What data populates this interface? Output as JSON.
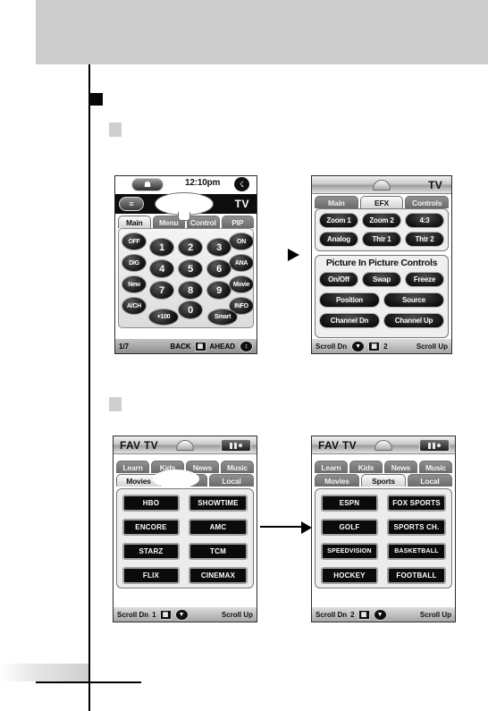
{
  "page": {
    "banner_label": "",
    "bullets": [
      {
        "name": "section-bullet-dark",
        "style": "dark"
      },
      {
        "name": "step-bullet-1",
        "style": "gray"
      },
      {
        "name": "step-bullet-2",
        "style": "gray"
      }
    ]
  },
  "screen_main": {
    "status": {
      "home_icon": "home-icon",
      "clock": "12:10pm",
      "battery_icon": "battery-icon"
    },
    "titlebar": {
      "menu_icon": "menu-list-icon",
      "title": "TV"
    },
    "tabs": [
      {
        "label": "Main",
        "active": true
      },
      {
        "label": "Menu",
        "active": false
      },
      {
        "label": "Control",
        "active": false
      },
      {
        "label": "PIP",
        "active": false
      }
    ],
    "left_keys": [
      "OFF",
      "DIG",
      "New",
      "A/CH"
    ],
    "right_keys": [
      "ON",
      "ANA",
      "Movie",
      "INFO"
    ],
    "numeric_keys": [
      "1",
      "2",
      "3",
      "4",
      "5",
      "6",
      "7",
      "8",
      "9",
      "0"
    ],
    "hundred_key": "+100",
    "smart_key": "Smart",
    "statusbar": {
      "page": "1/7",
      "back": "BACK",
      "ahead": "AHEAD",
      "center_icon": "book-icon",
      "right_icon": "updown-arrows-icon"
    }
  },
  "screen_efx": {
    "titlebar": {
      "title": "TV",
      "dome_icon": "dome-icon",
      "badge_icon": "device-icon"
    },
    "tabs": [
      {
        "label": "Main",
        "active": false
      },
      {
        "label": "EFX",
        "active": true
      },
      {
        "label": "Controls",
        "active": false
      }
    ],
    "aspect_keys": [
      "Zoom 1",
      "Zoom 2",
      "4:3",
      "Analog",
      "Thtr 1",
      "Thtr 2"
    ],
    "pip_heading": "Picture In Picture Controls",
    "pip_keys_row1": [
      "On/Off",
      "Swap",
      "Freeze"
    ],
    "pip_keys_row2": [
      "Position",
      "Source"
    ],
    "pip_keys_row3": [
      "Channel Dn",
      "Channel Up"
    ],
    "statusbar": {
      "scroll_down": "Scroll Dn",
      "scroll_up": "Scroll Up",
      "page": "2",
      "down_icon": "scroll-down-icon",
      "book_icon": "book-icon"
    }
  },
  "screen_fav_movies": {
    "titlebar": {
      "title": "FAV TV",
      "dome_icon": "dome-icon",
      "badge_icon": "device-icon"
    },
    "tabs_row1": [
      {
        "label": "Learn",
        "active": false
      },
      {
        "label": "Kids",
        "active": false
      },
      {
        "label": "News",
        "active": false
      },
      {
        "label": "Music",
        "active": false
      }
    ],
    "tabs_row2": [
      {
        "label": "Movies",
        "active": true
      },
      {
        "label": "",
        "active": false
      },
      {
        "label": "Local",
        "active": false
      }
    ],
    "channel_keys": [
      "HBO",
      "SHOWTIME",
      "ENCORE",
      "AMC",
      "STARZ",
      "TCM",
      "FLIX",
      "CINEMAX"
    ],
    "statusbar": {
      "scroll_down": "Scroll Dn",
      "scroll_up": "Scroll Up",
      "page": "1",
      "book_icon": "book-icon",
      "down_icon": "scroll-down-icon"
    }
  },
  "screen_fav_sports": {
    "titlebar": {
      "title": "FAV TV",
      "dome_icon": "dome-icon",
      "badge_icon": "device-icon"
    },
    "tabs_row1": [
      {
        "label": "Learn",
        "active": false
      },
      {
        "label": "Kids",
        "active": false
      },
      {
        "label": "News",
        "active": false
      },
      {
        "label": "Music",
        "active": false
      }
    ],
    "tabs_row2": [
      {
        "label": "Movies",
        "active": false
      },
      {
        "label": "Sports",
        "active": true
      },
      {
        "label": "Local",
        "active": false
      }
    ],
    "channel_keys": [
      "ESPN",
      "FOX SPORTS",
      "GOLF",
      "SPORTS CH.",
      "SPEEDVISION",
      "BASKETBALL",
      "HOCKEY",
      "FOOTBALL"
    ],
    "statusbar": {
      "scroll_down": "Scroll Dn",
      "scroll_up": "Scroll Up",
      "page": "2",
      "book_icon": "book-icon",
      "down_icon": "scroll-down-icon"
    }
  }
}
